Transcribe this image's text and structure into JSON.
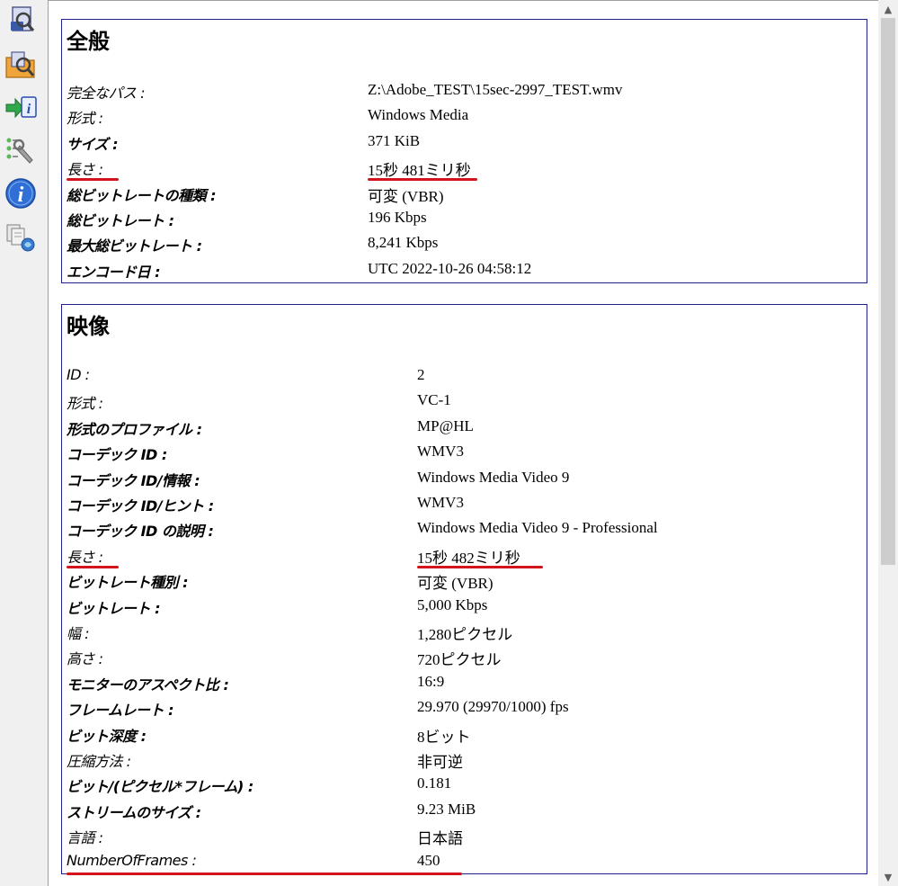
{
  "toolbar": {
    "buttons": [
      {
        "name": "open-file",
        "icon": "open-file-icon"
      },
      {
        "name": "open-folder",
        "icon": "open-folder-icon"
      },
      {
        "name": "export",
        "icon": "export-info-icon"
      },
      {
        "name": "preferences",
        "icon": "preferences-icon"
      },
      {
        "name": "about",
        "icon": "info-icon"
      },
      {
        "name": "knowledge",
        "icon": "knowledge-icon"
      }
    ]
  },
  "general": {
    "title": "全般",
    "rows": [
      {
        "label": "完全なパス :",
        "value": "Z:\\Adobe_TEST\\15sec-2997_TEST.wmv",
        "bold": false
      },
      {
        "label": "形式 :",
        "value": "Windows Media",
        "bold": false
      },
      {
        "label": "サイズ :",
        "value": "371 KiB",
        "bold": true
      },
      {
        "label": "長さ :",
        "value": "15秒 481ミリ秒",
        "bold": false,
        "highlight": true
      },
      {
        "label": "総ビットレートの種類 :",
        "value": "可変 (VBR)",
        "bold": true
      },
      {
        "label": "総ビットレート :",
        "value": "196 Kbps",
        "bold": true
      },
      {
        "label": "最大総ビットレート :",
        "value": "8,241 Kbps",
        "bold": true
      },
      {
        "label": "エンコード日 :",
        "value": "UTC 2022-10-26 04:58:12",
        "bold": true
      }
    ]
  },
  "video": {
    "title": "映像",
    "rows": [
      {
        "label": "ID :",
        "value": "2",
        "bold": false
      },
      {
        "label": "形式 :",
        "value": "VC-1",
        "bold": false
      },
      {
        "label": "形式のプロファイル :",
        "value": "MP@HL",
        "bold": true
      },
      {
        "label": "コーデック ID :",
        "value": "WMV3",
        "bold": true
      },
      {
        "label": "コーデック ID/情報 :",
        "value": "Windows Media Video 9",
        "bold": true
      },
      {
        "label": "コーデック ID/ヒント :",
        "value": "WMV3",
        "bold": true
      },
      {
        "label": "コーデック ID の説明 :",
        "value": "Windows Media Video 9 - Professional",
        "bold": true
      },
      {
        "label": "長さ :",
        "value": "15秒 482ミリ秒",
        "bold": false,
        "highlight": true
      },
      {
        "label": "ビットレート種別 :",
        "value": "可変 (VBR)",
        "bold": true
      },
      {
        "label": "ビットレート :",
        "value": "5,000 Kbps",
        "bold": true
      },
      {
        "label": "幅 :",
        "value": "1,280ピクセル",
        "bold": false
      },
      {
        "label": "高さ :",
        "value": "720ピクセル",
        "bold": false
      },
      {
        "label": "モニターのアスペクト比 :",
        "value": "16:9",
        "bold": true
      },
      {
        "label": "フレームレート :",
        "value": "29.970 (29970/1000) fps",
        "bold": true
      },
      {
        "label": "ビット深度 :",
        "value": "8ビット",
        "bold": true
      },
      {
        "label": "圧縮方法 :",
        "value": "非可逆",
        "bold": false
      },
      {
        "label": "ビット/(ピクセル*フレーム) :",
        "value": "0.181",
        "bold": true
      },
      {
        "label": "ストリームのサイズ :",
        "value": "9.23 MiB",
        "bold": true
      },
      {
        "label": "言語 :",
        "value": "日本語",
        "bold": false
      },
      {
        "label": "NumberOfFrames :",
        "value": "450",
        "bold": false,
        "highlight": true
      }
    ]
  },
  "colors": {
    "section_border": "#1f1f8f",
    "highlight": "#d4141c"
  }
}
